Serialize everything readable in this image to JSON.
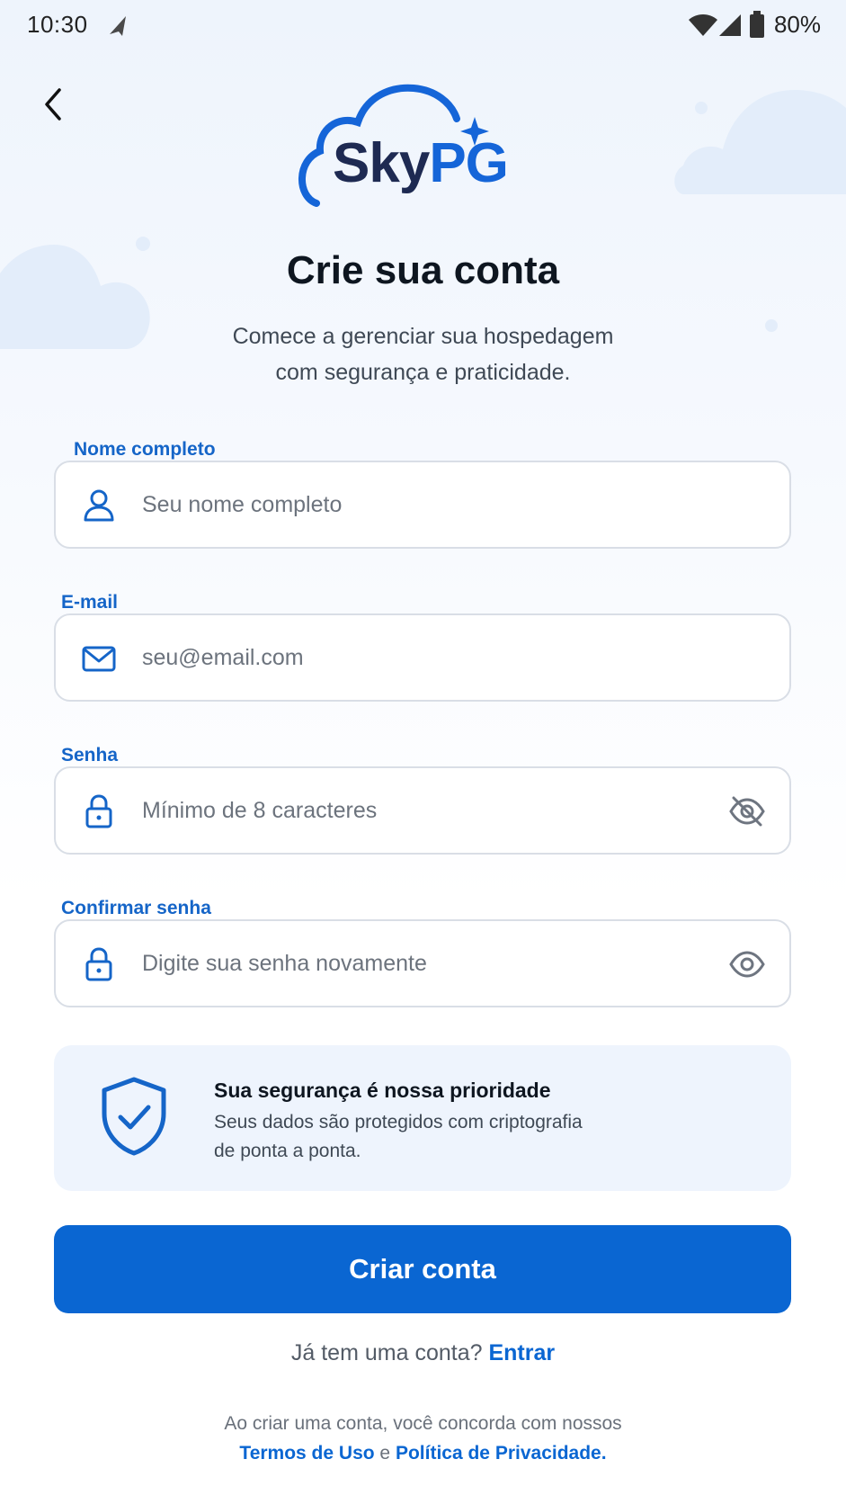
{
  "status_bar": {
    "time": "10:30",
    "battery_percent": "80%",
    "icons": [
      "navigation-arrow-icon",
      "wifi-icon",
      "cellular-signal-icon",
      "battery-icon"
    ]
  },
  "header": {
    "back_icon": "chevron-left-icon",
    "logo": {
      "text_sky": "Sky",
      "text_pg": "PG",
      "icon": "cloud-sparkle-logo"
    }
  },
  "intro": {
    "title": "Crie sua conta",
    "subtitle_line1": "Comece a gerenciar sua hospedagem",
    "subtitle_line2": "com segurança e praticidade."
  },
  "form": {
    "name": {
      "label": "Nome completo",
      "placeholder": "Seu nome completo",
      "value": "",
      "icon": "user-icon"
    },
    "email": {
      "label": "E-mail",
      "placeholder": "seu@email.com",
      "value": "",
      "icon": "mail-icon"
    },
    "password": {
      "label": "Senha",
      "placeholder": "Mínimo de 8 caracteres",
      "value": "",
      "icon": "lock-icon",
      "toggle_icon": "eye-off-icon"
    },
    "confirm_password": {
      "label": "Confirmar senha",
      "placeholder": "Digite sua senha novamente",
      "value": "",
      "icon": "lock-icon",
      "toggle_icon": "eye-icon"
    }
  },
  "security_note": {
    "icon": "shield-check-icon",
    "title": "Sua segurança é nossa prioridade",
    "description_line1": "Seus dados são protegidos com criptografia",
    "description_line2": "de ponta a ponta."
  },
  "actions": {
    "create_account": "Criar conta",
    "login_prompt": "Já tem uma conta?",
    "login_link": "Entrar"
  },
  "terms": {
    "prefix": "Ao criar uma conta, você concorda com nossos",
    "terms_link": "Termos de Uso",
    "connector": "e",
    "privacy_link": "Política de Privacidade",
    "suffix": "."
  },
  "colors": {
    "primary": "#0a66d2",
    "label_blue": "#1565c8",
    "logo_dark": "#1e2a52",
    "card_bg": "#eef4fd"
  }
}
